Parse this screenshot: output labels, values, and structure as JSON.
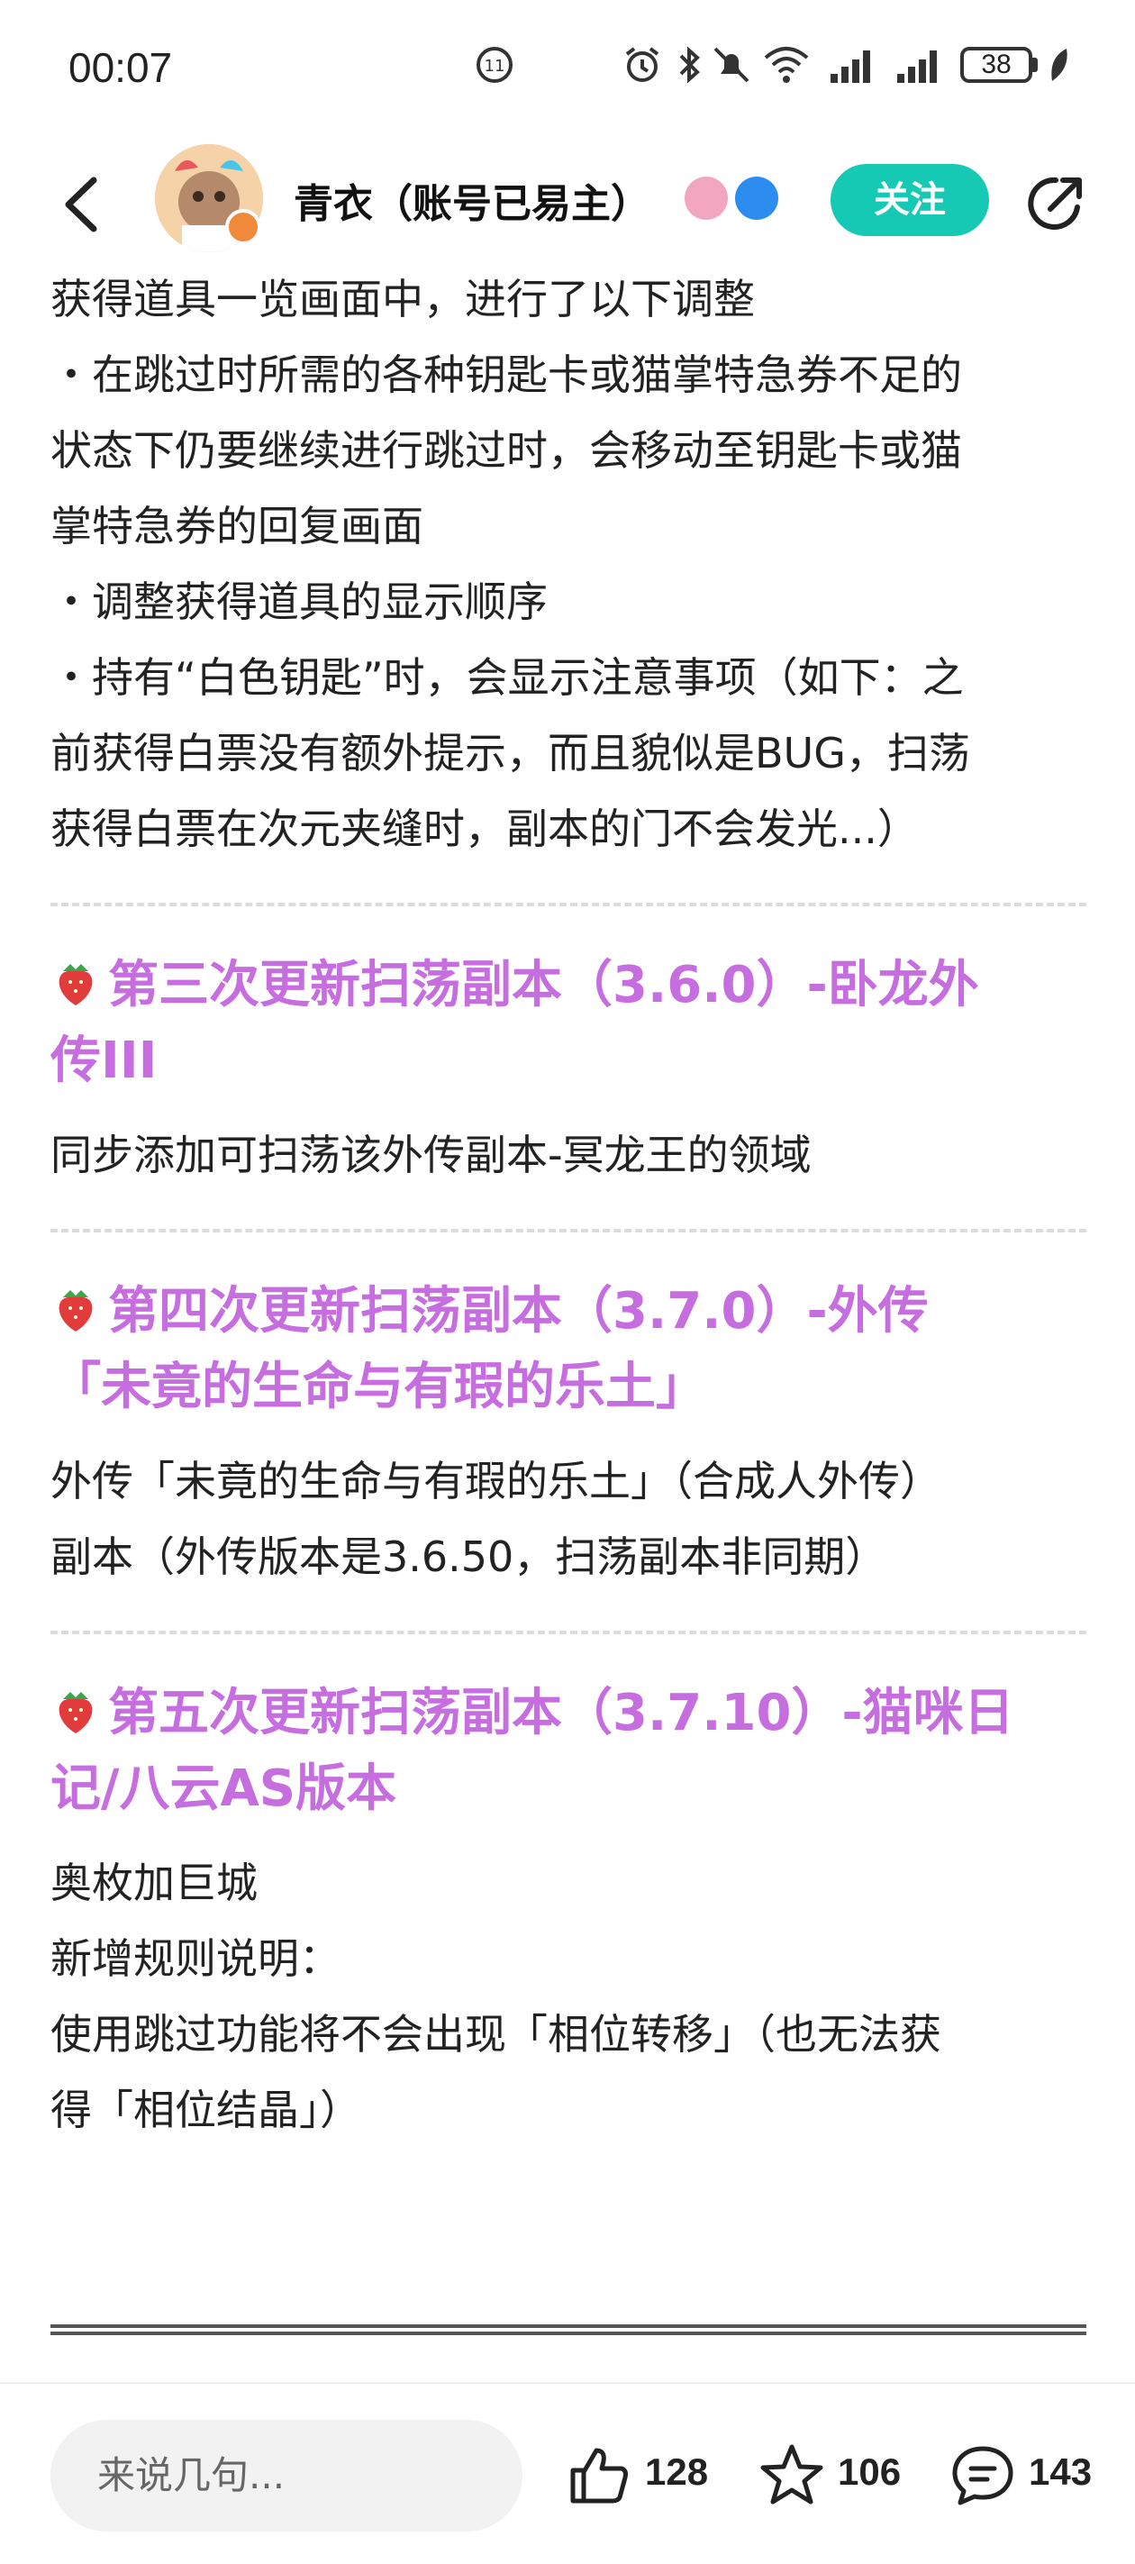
{
  "status_bar": {
    "time": "00:07",
    "battery": "38",
    "icons": [
      "app-notification-icon",
      "alarm-icon",
      "bluetooth-icon",
      "mute-icon",
      "wifi-icon",
      "signal-icon",
      "signal-icon",
      "battery-icon",
      "leaf-icon"
    ]
  },
  "header": {
    "author_name": "青衣（账号已易主）",
    "follow_label": "关注"
  },
  "article": {
    "intro_lines": [
      "获得道具一览画面中，进行了以下调整",
      "・在跳过时所需的各种钥匙卡或猫掌特急券不足的",
      "状态下仍要继续进行跳过时，会移动至钥匙卡或猫",
      "掌特急券的回复画面",
      "・调整获得道具的显示顺序",
      "・持有“白色钥匙”时，会显示注意事项（如下：之",
      "前获得白票没有额外提示，而且貌似是BUG，扫荡",
      "获得白票在次元夹缝时，副本的门不会发光...）"
    ],
    "sections": [
      {
        "title_lines": [
          "第三次更新扫荡副本（3.6.0）-卧龙外",
          "传III"
        ],
        "body_lines": [
          "同步添加可扫荡该外传副本-冥龙王的领域"
        ]
      },
      {
        "title_lines": [
          "第四次更新扫荡副本（3.7.0）-外传",
          "「未竟的生命与有瑕的乐土」"
        ],
        "body_lines": [
          "外传「未竟的生命与有瑕的乐土」（合成人外传）",
          "副本（外传版本是3.6.50，扫荡副本非同期）"
        ]
      },
      {
        "title_lines": [
          "第五次更新扫荡副本（3.7.10）-猫咪日",
          "记/八云AS版本"
        ],
        "body_lines": [
          "奥枚加巨城",
          "新增规则说明：",
          "使用跳过功能将不会出现「相位转移」（也无法获",
          "得「相位结晶」）"
        ]
      }
    ]
  },
  "bottom_bar": {
    "comment_placeholder": "来说几句...",
    "like_count": "128",
    "favorite_count": "106",
    "comment_count": "143"
  },
  "colors": {
    "accent": "#16c9b5",
    "section_title": "#c66de0"
  }
}
